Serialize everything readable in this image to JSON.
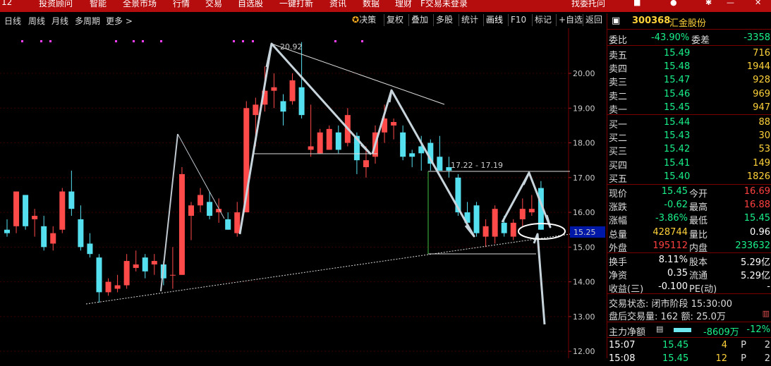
{
  "menu": {
    "items": [
      "12",
      "投资顾问",
      "智能",
      "全景市场",
      "行情",
      "交易",
      "自选股",
      "一键打新",
      "资讯",
      "数据",
      "理财",
      "F交易未登录",
      "找委托问"
    ]
  },
  "toolbar": {
    "periods": [
      "日线",
      "周线",
      "月线",
      "多周期",
      "更多 >"
    ],
    "buttons": [
      "决策",
      "复权",
      "叠加",
      "多股",
      "统计",
      "画线",
      "F10",
      "标记",
      "+自选",
      "返回"
    ]
  },
  "chart_data": {
    "type": "candlestick",
    "ylim": [
      11.8,
      21.3
    ],
    "yticks": [
      "20.00",
      "19.00",
      "18.00",
      "17.00",
      "16.00",
      "15.00",
      "14.00",
      "13.00",
      "12.00"
    ],
    "current_price_label": "15.25",
    "annotations": [
      "20.92",
      "17.22 - 17.19"
    ],
    "colors": {
      "up": "#ff4a4a",
      "down": "#55e0f0",
      "grid": "#3a0000"
    },
    "candles": [
      {
        "o": 15.5,
        "h": 15.8,
        "l": 15.3,
        "c": 15.4
      },
      {
        "o": 15.6,
        "h": 16.6,
        "l": 15.4,
        "c": 16.6
      },
      {
        "o": 16.5,
        "h": 16.5,
        "l": 15.5,
        "c": 15.6
      },
      {
        "o": 15.8,
        "h": 16.1,
        "l": 15.3,
        "c": 15.9
      },
      {
        "o": 15.6,
        "h": 15.9,
        "l": 14.9,
        "c": 15.0
      },
      {
        "o": 15.1,
        "h": 15.6,
        "l": 14.9,
        "c": 15.4
      },
      {
        "o": 15.5,
        "h": 16.7,
        "l": 15.4,
        "c": 16.6
      },
      {
        "o": 16.6,
        "h": 17.2,
        "l": 15.9,
        "c": 16.1
      },
      {
        "o": 15.8,
        "h": 16.2,
        "l": 14.9,
        "c": 15.0
      },
      {
        "o": 15.1,
        "h": 15.4,
        "l": 14.7,
        "c": 14.8
      },
      {
        "o": 14.7,
        "h": 14.8,
        "l": 13.4,
        "c": 13.7
      },
      {
        "o": 13.7,
        "h": 14.1,
        "l": 13.6,
        "c": 14.0
      },
      {
        "o": 13.8,
        "h": 14.2,
        "l": 13.7,
        "c": 13.9
      },
      {
        "o": 13.9,
        "h": 14.8,
        "l": 13.8,
        "c": 14.6
      },
      {
        "o": 14.4,
        "h": 14.9,
        "l": 14.3,
        "c": 14.5
      },
      {
        "o": 14.7,
        "h": 14.8,
        "l": 14.1,
        "c": 14.3
      },
      {
        "o": 14.5,
        "h": 14.8,
        "l": 14.2,
        "c": 14.6
      },
      {
        "o": 14.5,
        "h": 14.6,
        "l": 13.9,
        "c": 14.1
      },
      {
        "o": 14.2,
        "h": 15.0,
        "l": 13.8,
        "c": 14.2
      },
      {
        "o": 14.2,
        "h": 17.3,
        "l": 14.2,
        "c": 17.1
      },
      {
        "o": 15.9,
        "h": 16.3,
        "l": 15.2,
        "c": 16.2
      },
      {
        "o": 16.2,
        "h": 16.7,
        "l": 16.0,
        "c": 16.5
      },
      {
        "o": 16.3,
        "h": 16.6,
        "l": 15.8,
        "c": 15.9
      },
      {
        "o": 16.0,
        "h": 16.4,
        "l": 15.7,
        "c": 16.1
      },
      {
        "o": 15.8,
        "h": 16.0,
        "l": 15.5,
        "c": 15.5
      },
      {
        "o": 15.4,
        "h": 16.3,
        "l": 15.3,
        "c": 16.0
      },
      {
        "o": 16.0,
        "h": 19.2,
        "l": 16.0,
        "c": 19.0
      },
      {
        "o": 18.8,
        "h": 19.3,
        "l": 17.9,
        "c": 19.1
      },
      {
        "o": 19.1,
        "h": 20.2,
        "l": 18.9,
        "c": 19.5
      },
      {
        "o": 19.5,
        "h": 20.0,
        "l": 19.0,
        "c": 19.6
      },
      {
        "o": 19.2,
        "h": 19.4,
        "l": 18.5,
        "c": 18.9
      },
      {
        "o": 19.2,
        "h": 20.0,
        "l": 19.1,
        "c": 19.8
      },
      {
        "o": 19.6,
        "h": 20.9,
        "l": 18.7,
        "c": 18.8
      },
      {
        "o": 17.8,
        "h": 19.1,
        "l": 17.6,
        "c": 17.9
      },
      {
        "o": 17.7,
        "h": 18.4,
        "l": 17.7,
        "c": 18.3
      },
      {
        "o": 17.8,
        "h": 18.5,
        "l": 17.8,
        "c": 18.4
      },
      {
        "o": 18.3,
        "h": 18.5,
        "l": 17.7,
        "c": 17.8
      },
      {
        "o": 18.0,
        "h": 19.0,
        "l": 17.9,
        "c": 18.8
      },
      {
        "o": 18.2,
        "h": 18.3,
        "l": 17.1,
        "c": 17.5
      },
      {
        "o": 17.3,
        "h": 17.9,
        "l": 17.0,
        "c": 17.5
      },
      {
        "o": 17.6,
        "h": 18.5,
        "l": 17.4,
        "c": 18.3
      },
      {
        "o": 18.3,
        "h": 19.1,
        "l": 18.0,
        "c": 18.7
      },
      {
        "o": 18.5,
        "h": 18.7,
        "l": 18.1,
        "c": 18.6
      },
      {
        "o": 18.3,
        "h": 18.5,
        "l": 17.5,
        "c": 17.6
      },
      {
        "o": 17.7,
        "h": 17.8,
        "l": 17.3,
        "c": 17.6
      },
      {
        "o": 17.9,
        "h": 18.2,
        "l": 17.2,
        "c": 17.7
      },
      {
        "o": 18.0,
        "h": 18.1,
        "l": 17.2,
        "c": 17.4
      },
      {
        "o": 17.6,
        "h": 18.2,
        "l": 17.2,
        "c": 17.2
      },
      {
        "o": 17.3,
        "h": 17.6,
        "l": 17.0,
        "c": 17.2
      },
      {
        "o": 17.0,
        "h": 17.1,
        "l": 15.9,
        "c": 16.0
      },
      {
        "o": 16.0,
        "h": 16.3,
        "l": 15.6,
        "c": 15.7
      },
      {
        "o": 16.2,
        "h": 16.3,
        "l": 15.3,
        "c": 15.4
      },
      {
        "o": 15.3,
        "h": 15.8,
        "l": 15.0,
        "c": 15.6
      },
      {
        "o": 15.3,
        "h": 16.2,
        "l": 15.1,
        "c": 16.1
      },
      {
        "o": 15.7,
        "h": 15.9,
        "l": 15.3,
        "c": 15.4
      },
      {
        "o": 15.3,
        "h": 15.8,
        "l": 15.2,
        "c": 15.7
      },
      {
        "o": 15.8,
        "h": 16.4,
        "l": 15.6,
        "c": 16.1
      },
      {
        "o": 16.0,
        "h": 16.5,
        "l": 15.9,
        "c": 16.1
      },
      {
        "o": 16.7,
        "h": 16.9,
        "l": 15.5,
        "c": 15.5
      }
    ]
  },
  "quote": {
    "code": "300368",
    "name": "汇金股份",
    "webi_label": "委比",
    "webi_value": "-43.90%",
    "weicha_label": "委差",
    "weicha_value": "-3358",
    "asks": [
      {
        "label": "卖五",
        "price": "15.49",
        "vol": "716"
      },
      {
        "label": "卖四",
        "price": "15.48",
        "vol": "1944"
      },
      {
        "label": "卖三",
        "price": "15.47",
        "vol": "928"
      },
      {
        "label": "卖二",
        "price": "15.46",
        "vol": "969"
      },
      {
        "label": "卖一",
        "price": "15.45",
        "vol": "947"
      }
    ],
    "bids": [
      {
        "label": "买一",
        "price": "15.44",
        "vol": "88"
      },
      {
        "label": "买二",
        "price": "15.43",
        "vol": "30"
      },
      {
        "label": "买三",
        "price": "15.42",
        "vol": "53"
      },
      {
        "label": "买四",
        "price": "15.41",
        "vol": "149"
      },
      {
        "label": "买五",
        "price": "15.40",
        "vol": "1826"
      }
    ],
    "stats": [
      {
        "l1": "现价",
        "v1": "15.45",
        "l2": "今开",
        "v2": "16.69"
      },
      {
        "l1": "涨跌",
        "v1": "-0.62",
        "l2": "最高",
        "v2": "16.88"
      },
      {
        "l1": "涨幅",
        "v1": "-3.86%",
        "l2": "最低",
        "v2": "15.45"
      },
      {
        "l1": "总量",
        "v1": "428744",
        "l2": "量比",
        "v2": "0.96"
      },
      {
        "l1": "外盘",
        "v1": "195112",
        "l2": "内盘",
        "v2": "233632"
      }
    ],
    "stats2": [
      {
        "l1": "换手",
        "v1": "8.11%",
        "l2": "股本",
        "v2": "5.29亿"
      },
      {
        "l1": "净资",
        "v1": "0.35",
        "l2": "流通",
        "v2": "5.29亿"
      },
      {
        "l1": "收益(三)",
        "v1": "-0.100",
        "l2": "PE(动)",
        "v2": "-"
      }
    ],
    "status_text": "交易状态: 闭市阶段 15:30:00",
    "after_hours_text": "盘后交易量: 162  额: 25.0万",
    "main_net_label": "主力净额",
    "main_net_value": "-8609万",
    "main_net_pct": "-12%",
    "ticks": [
      {
        "time": "15:07",
        "price": "15.45",
        "vol": "4",
        "side": "P",
        "n": "2"
      },
      {
        "time": "15:08",
        "price": "15.45",
        "vol": "12",
        "side": "P",
        "n": "2"
      }
    ]
  }
}
